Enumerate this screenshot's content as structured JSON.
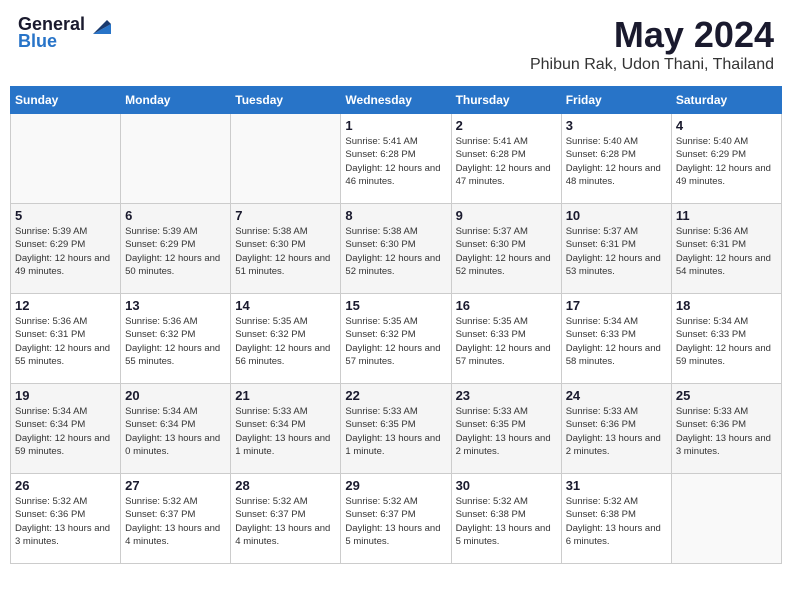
{
  "header": {
    "logo_general": "General",
    "logo_blue": "Blue",
    "month_year": "May 2024",
    "location": "Phibun Rak, Udon Thani, Thailand"
  },
  "days_header": [
    "Sunday",
    "Monday",
    "Tuesday",
    "Wednesday",
    "Thursday",
    "Friday",
    "Saturday"
  ],
  "weeks": [
    [
      {
        "num": "",
        "info": ""
      },
      {
        "num": "",
        "info": ""
      },
      {
        "num": "",
        "info": ""
      },
      {
        "num": "1",
        "info": "Sunrise: 5:41 AM\nSunset: 6:28 PM\nDaylight: 12 hours\nand 46 minutes."
      },
      {
        "num": "2",
        "info": "Sunrise: 5:41 AM\nSunset: 6:28 PM\nDaylight: 12 hours\nand 47 minutes."
      },
      {
        "num": "3",
        "info": "Sunrise: 5:40 AM\nSunset: 6:28 PM\nDaylight: 12 hours\nand 48 minutes."
      },
      {
        "num": "4",
        "info": "Sunrise: 5:40 AM\nSunset: 6:29 PM\nDaylight: 12 hours\nand 49 minutes."
      }
    ],
    [
      {
        "num": "5",
        "info": "Sunrise: 5:39 AM\nSunset: 6:29 PM\nDaylight: 12 hours\nand 49 minutes."
      },
      {
        "num": "6",
        "info": "Sunrise: 5:39 AM\nSunset: 6:29 PM\nDaylight: 12 hours\nand 50 minutes."
      },
      {
        "num": "7",
        "info": "Sunrise: 5:38 AM\nSunset: 6:30 PM\nDaylight: 12 hours\nand 51 minutes."
      },
      {
        "num": "8",
        "info": "Sunrise: 5:38 AM\nSunset: 6:30 PM\nDaylight: 12 hours\nand 52 minutes."
      },
      {
        "num": "9",
        "info": "Sunrise: 5:37 AM\nSunset: 6:30 PM\nDaylight: 12 hours\nand 52 minutes."
      },
      {
        "num": "10",
        "info": "Sunrise: 5:37 AM\nSunset: 6:31 PM\nDaylight: 12 hours\nand 53 minutes."
      },
      {
        "num": "11",
        "info": "Sunrise: 5:36 AM\nSunset: 6:31 PM\nDaylight: 12 hours\nand 54 minutes."
      }
    ],
    [
      {
        "num": "12",
        "info": "Sunrise: 5:36 AM\nSunset: 6:31 PM\nDaylight: 12 hours\nand 55 minutes."
      },
      {
        "num": "13",
        "info": "Sunrise: 5:36 AM\nSunset: 6:32 PM\nDaylight: 12 hours\nand 55 minutes."
      },
      {
        "num": "14",
        "info": "Sunrise: 5:35 AM\nSunset: 6:32 PM\nDaylight: 12 hours\nand 56 minutes."
      },
      {
        "num": "15",
        "info": "Sunrise: 5:35 AM\nSunset: 6:32 PM\nDaylight: 12 hours\nand 57 minutes."
      },
      {
        "num": "16",
        "info": "Sunrise: 5:35 AM\nSunset: 6:33 PM\nDaylight: 12 hours\nand 57 minutes."
      },
      {
        "num": "17",
        "info": "Sunrise: 5:34 AM\nSunset: 6:33 PM\nDaylight: 12 hours\nand 58 minutes."
      },
      {
        "num": "18",
        "info": "Sunrise: 5:34 AM\nSunset: 6:33 PM\nDaylight: 12 hours\nand 59 minutes."
      }
    ],
    [
      {
        "num": "19",
        "info": "Sunrise: 5:34 AM\nSunset: 6:34 PM\nDaylight: 12 hours\nand 59 minutes."
      },
      {
        "num": "20",
        "info": "Sunrise: 5:34 AM\nSunset: 6:34 PM\nDaylight: 13 hours\nand 0 minutes."
      },
      {
        "num": "21",
        "info": "Sunrise: 5:33 AM\nSunset: 6:34 PM\nDaylight: 13 hours\nand 1 minute."
      },
      {
        "num": "22",
        "info": "Sunrise: 5:33 AM\nSunset: 6:35 PM\nDaylight: 13 hours\nand 1 minute."
      },
      {
        "num": "23",
        "info": "Sunrise: 5:33 AM\nSunset: 6:35 PM\nDaylight: 13 hours\nand 2 minutes."
      },
      {
        "num": "24",
        "info": "Sunrise: 5:33 AM\nSunset: 6:36 PM\nDaylight: 13 hours\nand 2 minutes."
      },
      {
        "num": "25",
        "info": "Sunrise: 5:33 AM\nSunset: 6:36 PM\nDaylight: 13 hours\nand 3 minutes."
      }
    ],
    [
      {
        "num": "26",
        "info": "Sunrise: 5:32 AM\nSunset: 6:36 PM\nDaylight: 13 hours\nand 3 minutes."
      },
      {
        "num": "27",
        "info": "Sunrise: 5:32 AM\nSunset: 6:37 PM\nDaylight: 13 hours\nand 4 minutes."
      },
      {
        "num": "28",
        "info": "Sunrise: 5:32 AM\nSunset: 6:37 PM\nDaylight: 13 hours\nand 4 minutes."
      },
      {
        "num": "29",
        "info": "Sunrise: 5:32 AM\nSunset: 6:37 PM\nDaylight: 13 hours\nand 5 minutes."
      },
      {
        "num": "30",
        "info": "Sunrise: 5:32 AM\nSunset: 6:38 PM\nDaylight: 13 hours\nand 5 minutes."
      },
      {
        "num": "31",
        "info": "Sunrise: 5:32 AM\nSunset: 6:38 PM\nDaylight: 13 hours\nand 6 minutes."
      },
      {
        "num": "",
        "info": ""
      }
    ]
  ]
}
